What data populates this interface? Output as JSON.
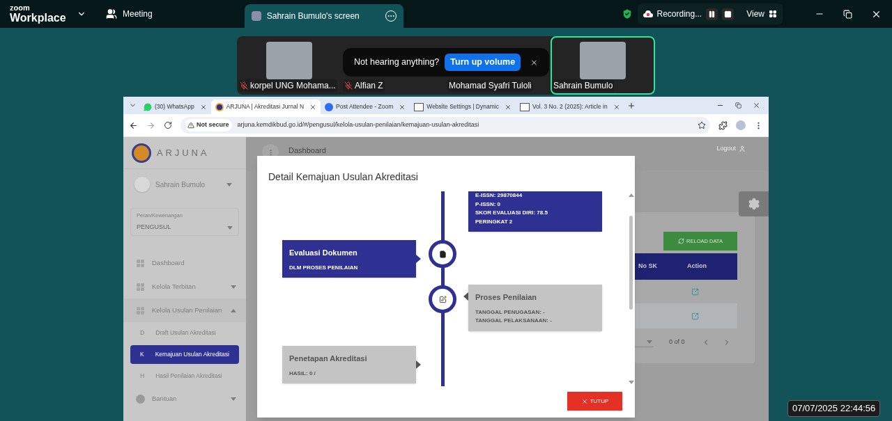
{
  "zoom_bar": {
    "logo_top": "zoom",
    "logo_bottom": "Workplace",
    "tabs": [
      {
        "label": "Meeting",
        "selected": false
      },
      {
        "label": "Sahrain Bumulo's screen",
        "selected": true
      }
    ],
    "recording_label": "Recording...",
    "view_label": "View"
  },
  "participants": [
    {
      "name": "korpel UNG Mohama...",
      "muted": true,
      "video": true,
      "speaking": false
    },
    {
      "name": "Alfian Z",
      "muted": true,
      "video": false,
      "speaking": false
    },
    {
      "name": "Mohamad Syafri Tuloli",
      "muted": false,
      "video": false,
      "speaking": false
    },
    {
      "name": "Sahrain Bumulo",
      "muted": false,
      "video": true,
      "speaking": true
    }
  ],
  "audio_prompt": {
    "text": "Not hearing anything?",
    "button": "Turn up volume"
  },
  "browser": {
    "tabs": [
      {
        "title": "(30) WhatsApp",
        "kind": "chat",
        "selected": false
      },
      {
        "title": "ARJUNA | Akreditasi Jurnal N",
        "kind": "site",
        "selected": true
      },
      {
        "title": "Post Attendee - Zoom",
        "kind": "zoom",
        "selected": false
      },
      {
        "title": "Website Settings | Dynamic",
        "kind": "journal",
        "selected": false
      },
      {
        "title": "Vol. 3 No. 2 (2025): Article in",
        "kind": "journal",
        "selected": false
      }
    ],
    "security_label": "Not secure",
    "url": "arjuna.kemdikbud.go.id/#/pengusul/kelola-usulan-penilaian/kemajuan-usulan-akreditasi"
  },
  "sidebar": {
    "logo": "ARJUNA",
    "user": "Sahrain Bumulo",
    "role_field": {
      "label": "Peran/Kewenangan",
      "value": "PENGUSUL"
    },
    "items": [
      {
        "label": "Dashboard",
        "kind": "link"
      },
      {
        "label": "Kelola Terbitan",
        "kind": "group",
        "expanded": false
      },
      {
        "label": "Kelola Usulan Penilaian",
        "kind": "group",
        "expanded": true,
        "children": [
          {
            "letter": "D",
            "label": "Draft Usulan Akreditasi",
            "selected": false
          },
          {
            "letter": "K",
            "label": "Kemajuan Usulan Akreditasi",
            "selected": true
          },
          {
            "letter": "H",
            "label": "Hasil Penilaian Akreditasi",
            "selected": false
          }
        ]
      },
      {
        "label": "Bantuan",
        "kind": "help",
        "expanded": false
      }
    ]
  },
  "main": {
    "header": "Dashboard",
    "logout": "Logout",
    "reload_button": "RELOAD DATA",
    "table": {
      "columns": [
        "No SK",
        "Action"
      ],
      "rows": [
        {
          "selected": false
        },
        {
          "selected": true
        }
      ]
    },
    "pagination": "0 of 0"
  },
  "modal": {
    "title": "Detail Kemajuan Usulan Akreditasi",
    "timeline": [
      {
        "active": true,
        "kind": "info",
        "lines": [
          "E-ISSN: 29870844",
          "P-ISSN: 0",
          "SKOR EVALUASI DIRI: 78.5",
          "PERINGKAT 2"
        ]
      },
      {
        "active": true,
        "kind": "document",
        "title": "Evaluasi Dokumen",
        "lines": [
          "DLM PROSES PENILAIAN"
        ]
      },
      {
        "active": false,
        "kind": "review",
        "title": "Proses Penilaian",
        "lines": [
          "TANGGAL PENUGASAN: -",
          "TANGGAL PELAKSANAAN: -"
        ]
      },
      {
        "active": false,
        "kind": "result",
        "title": "Penetapan Akreditasi",
        "lines": [
          "HASIL: 0 /"
        ]
      }
    ],
    "close_button": "TUTUP"
  },
  "timestamp": "07/07/2025 22:44:56"
}
